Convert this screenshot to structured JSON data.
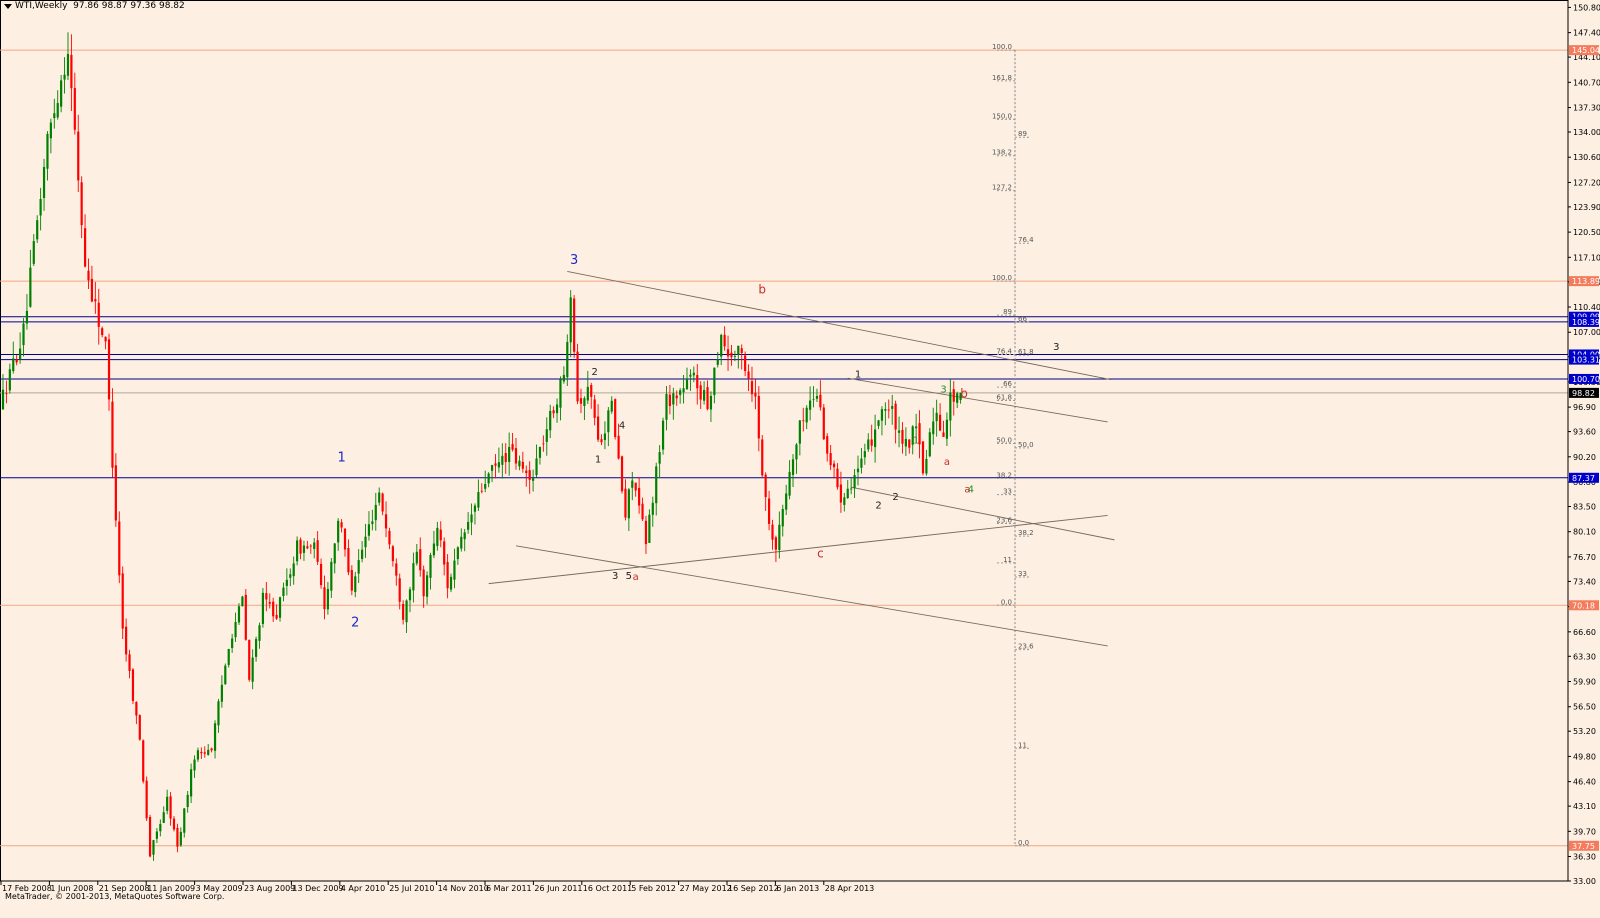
{
  "title": "WTI,Weekly  97.86 98.87 97.36 98.82",
  "copyright": "MetaTrader, © 2001-2013, MetaQuotes Software Corp.",
  "colors": {
    "bull": "#008000",
    "bear": "#ff0000",
    "background": "#fdf0e2",
    "blue_line": "#00008b",
    "salmon_line": "#f4a582",
    "trend_line": "#7a6a5a"
  },
  "price_axis": {
    "min": 33.0,
    "max": 151.8,
    "ticks": [
      "150.80",
      "147.40",
      "144.10",
      "140.70",
      "137.30",
      "134.00",
      "130.60",
      "127.20",
      "123.90",
      "120.50",
      "117.10",
      "113.80",
      "110.40",
      "107.00",
      "103.70",
      "100.30",
      "96.90",
      "93.60",
      "90.20",
      "86.80",
      "83.50",
      "80.10",
      "76.70",
      "73.40",
      "70.00",
      "66.60",
      "63.30",
      "59.90",
      "56.50",
      "53.20",
      "49.80",
      "46.40",
      "43.10",
      "39.70",
      "36.30",
      "33.00"
    ]
  },
  "time_axis": {
    "labels": [
      "17 Feb 2008",
      "1 Jun 2008",
      "21 Sep 2008",
      "11 Jan 2009",
      "3 May 2009",
      "23 Aug 2009",
      "13 Dec 2009",
      "4 Apr 2010",
      "25 Jul 2010",
      "14 Nov 2010",
      "6 Mar 2011",
      "26 Jun 2011",
      "16 Oct 2011",
      "5 Feb 2012",
      "27 May 2012",
      "16 Sep 2012",
      "6 Jan 2013",
      "28 Apr 2013"
    ]
  },
  "horizontal_levels": [
    {
      "price": 145.04,
      "label": "145.04",
      "kind": "salmon"
    },
    {
      "price": 113.89,
      "label": "113.89",
      "kind": "salmon"
    },
    {
      "price": 109.09,
      "label": "109.09",
      "kind": "blue"
    },
    {
      "price": 108.39,
      "label": "108.39",
      "kind": "blue"
    },
    {
      "price": 104.0,
      "label": "104.00",
      "kind": "blue"
    },
    {
      "price": 103.31,
      "label": "103.31",
      "kind": "blue"
    },
    {
      "price": 100.7,
      "label": "100.70",
      "kind": "blue"
    },
    {
      "price": 98.82,
      "label": "98.82",
      "kind": "current"
    },
    {
      "price": 87.37,
      "label": "87.37",
      "kind": "blue"
    },
    {
      "price": 70.18,
      "label": "70.18",
      "kind": "salmon"
    },
    {
      "price": 37.75,
      "label": "37.75",
      "kind": "salmon"
    }
  ],
  "fib_left": [
    {
      "label": "100.0",
      "price": 145.04
    },
    {
      "label": "161.8",
      "price": 140.9
    },
    {
      "label": "150.0",
      "price": 135.7
    },
    {
      "label": "138.2",
      "price": 130.8
    },
    {
      "label": "127.2",
      "price": 126.1
    },
    {
      "label": "100.0",
      "price": 113.89
    },
    {
      "label": "89",
      "price": 109.3
    },
    {
      "label": "76.4",
      "price": 104.0
    },
    {
      "label": "66",
      "price": 99.6
    },
    {
      "label": "61.8",
      "price": 97.8
    },
    {
      "label": "50.0",
      "price": 92.0
    },
    {
      "label": "38.2",
      "price": 87.3
    },
    {
      "label": "33",
      "price": 85.1
    },
    {
      "label": "23.6",
      "price": 81.2
    },
    {
      "label": "11",
      "price": 75.9
    },
    {
      "label": "0.0",
      "price": 70.18
    }
  ],
  "fib_right": [
    {
      "label": "89",
      "price": 133.3
    },
    {
      "label": "76.4",
      "price": 119.0
    },
    {
      "label": "66",
      "price": 108.4
    },
    {
      "label": "61.8",
      "price": 103.9
    },
    {
      "label": "50.0",
      "price": 91.4
    },
    {
      "label": "38.2",
      "price": 79.5
    },
    {
      "label": "33",
      "price": 74.0
    },
    {
      "label": "23.6",
      "price": 64.2
    },
    {
      "label": "11",
      "price": 50.9
    },
    {
      "label": "0.0",
      "price": 37.75
    }
  ],
  "wave_labels": [
    {
      "text": "1",
      "color": "blue",
      "date": "2010-01-10",
      "price": 89.6
    },
    {
      "text": "2",
      "color": "blue",
      "date": "2010-02-07",
      "price": 67.3
    },
    {
      "text": "3",
      "color": "blue",
      "date": "2011-05-01",
      "price": 116.2
    },
    {
      "text": "2",
      "color": "dark",
      "date": "2011-06-12",
      "price": 101.2
    },
    {
      "text": "1",
      "color": "dark",
      "date": "2011-06-19",
      "price": 89.4
    },
    {
      "text": "4",
      "color": "dark",
      "date": "2011-08-07",
      "price": 94.0
    },
    {
      "text": "3",
      "color": "dark",
      "date": "2011-07-24",
      "price": 73.7
    },
    {
      "text": "5",
      "color": "dark",
      "date": "2011-08-21",
      "price": 73.7
    },
    {
      "text": "a",
      "color": "red",
      "date": "2011-09-04",
      "price": 73.6
    },
    {
      "text": "b",
      "color": "red",
      "date": "2012-05-20",
      "price": 112.2
    },
    {
      "text": "c",
      "color": "red",
      "date": "2012-09-16",
      "price": 76.6
    },
    {
      "text": "1",
      "color": "dark",
      "date": "2012-12-02",
      "price": 100.9
    },
    {
      "text": "2",
      "color": "dark",
      "date": "2013-01-13",
      "price": 83.2
    },
    {
      "text": "2",
      "color": "dark",
      "date": "2013-02-17",
      "price": 84.4
    },
    {
      "text": "1",
      "color": "green",
      "date": "2013-03-31",
      "price": 92.0
    },
    {
      "text": "3",
      "color": "green",
      "date": "2013-05-26",
      "price": 98.9
    },
    {
      "text": "a",
      "color": "red",
      "date": "2013-06-02",
      "price": 89.1
    },
    {
      "text": "b",
      "color": "red",
      "date": "2013-07-07",
      "price": 98.2
    },
    {
      "text": "a",
      "color": "red",
      "date": "2013-07-14",
      "price": 85.4
    },
    {
      "text": "4",
      "color": "green",
      "date": "2013-07-21",
      "price": 85.4
    },
    {
      "text": "3",
      "color": "dark",
      "date": "2014-01-12",
      "price": 104.6
    }
  ],
  "trend_lines": [
    {
      "from": {
        "date": "2011-04-17",
        "price": 115.2
      },
      "to": {
        "date": "2014-05-04",
        "price": 100.6
      }
    },
    {
      "from": {
        "date": "2012-11-11",
        "price": 100.8
      },
      "to": {
        "date": "2014-04-27",
        "price": 94.9
      }
    },
    {
      "from": {
        "date": "2012-11-18",
        "price": 86.1
      },
      "to": {
        "date": "2014-05-11",
        "price": 79.0
      }
    },
    {
      "from": {
        "date": "2010-11-07",
        "price": 73.1
      },
      "to": {
        "date": "2014-04-27",
        "price": 82.3
      }
    },
    {
      "from": {
        "date": "2011-01-02",
        "price": 78.2
      },
      "to": {
        "date": "2014-04-27",
        "price": 64.7
      }
    }
  ],
  "chart_data": {
    "type": "candlestick",
    "symbol": "WTI",
    "timeframe": "Weekly",
    "start_date": "2008-02-17",
    "anchors": [
      [
        "2008-02-17",
        97
      ],
      [
        "2008-04-06",
        107
      ],
      [
        "2008-05-25",
        133
      ],
      [
        "2008-07-06",
        145.3
      ],
      [
        "2008-08-10",
        116
      ],
      [
        "2008-09-21",
        105
      ],
      [
        "2008-10-26",
        67
      ],
      [
        "2008-11-30",
        52
      ],
      [
        "2008-12-21",
        36.5
      ],
      [
        "2009-01-25",
        44
      ],
      [
        "2009-02-15",
        37.5
      ],
      [
        "2009-03-22",
        50
      ],
      [
        "2009-04-26",
        51
      ],
      [
        "2009-05-31",
        65
      ],
      [
        "2009-06-28",
        71
      ],
      [
        "2009-07-12",
        60
      ],
      [
        "2009-08-09",
        71
      ],
      [
        "2009-09-06",
        69
      ],
      [
        "2009-10-18",
        78
      ],
      [
        "2009-11-22",
        78
      ],
      [
        "2009-12-13",
        70
      ],
      [
        "2010-01-10",
        82
      ],
      [
        "2010-02-07",
        73
      ],
      [
        "2010-04-04",
        85.5
      ],
      [
        "2010-05-23",
        69
      ],
      [
        "2010-06-20",
        77
      ],
      [
        "2010-07-04",
        72
      ],
      [
        "2010-08-01",
        81
      ],
      [
        "2010-08-22",
        73
      ],
      [
        "2010-09-26",
        80
      ],
      [
        "2010-11-07",
        87
      ],
      [
        "2010-12-26",
        91
      ],
      [
        "2011-02-06",
        87
      ],
      [
        "2011-04-17",
        101
      ],
      [
        "2011-05-01",
        113
      ],
      [
        "2011-05-15",
        98
      ],
      [
        "2011-06-12",
        99
      ],
      [
        "2011-06-26",
        92
      ],
      [
        "2011-07-24",
        97
      ],
      [
        "2011-08-21",
        82
      ],
      [
        "2011-09-04",
        88
      ],
      [
        "2011-10-02",
        78.5
      ],
      [
        "2011-11-13",
        98
      ],
      [
        "2011-12-11",
        99
      ],
      [
        "2012-01-08",
        101
      ],
      [
        "2012-02-05",
        97
      ],
      [
        "2012-03-04",
        107
      ],
      [
        "2012-03-18",
        104
      ],
      [
        "2012-04-15",
        104
      ],
      [
        "2012-05-13",
        98
      ],
      [
        "2012-06-03",
        84
      ],
      [
        "2012-06-24",
        78
      ],
      [
        "2012-07-22",
        88
      ],
      [
        "2012-08-19",
        96
      ],
      [
        "2012-09-16",
        99
      ],
      [
        "2012-10-07",
        91
      ],
      [
        "2012-11-04",
        85
      ],
      [
        "2012-11-25",
        87
      ],
      [
        "2012-12-23",
        90
      ],
      [
        "2013-01-27",
        97
      ],
      [
        "2013-02-17",
        96
      ],
      [
        "2013-03-10",
        91
      ],
      [
        "2013-04-07",
        94
      ],
      [
        "2013-04-21",
        88
      ],
      [
        "2013-05-12",
        96
      ],
      [
        "2013-06-02",
        94
      ],
      [
        "2013-06-16",
        98
      ],
      [
        "2013-06-30",
        98.82
      ]
    ],
    "last_bar": {
      "open": 97.86,
      "high": 98.87,
      "low": 97.36,
      "close": 98.82
    },
    "ylim": [
      33.0,
      151.8
    ]
  }
}
